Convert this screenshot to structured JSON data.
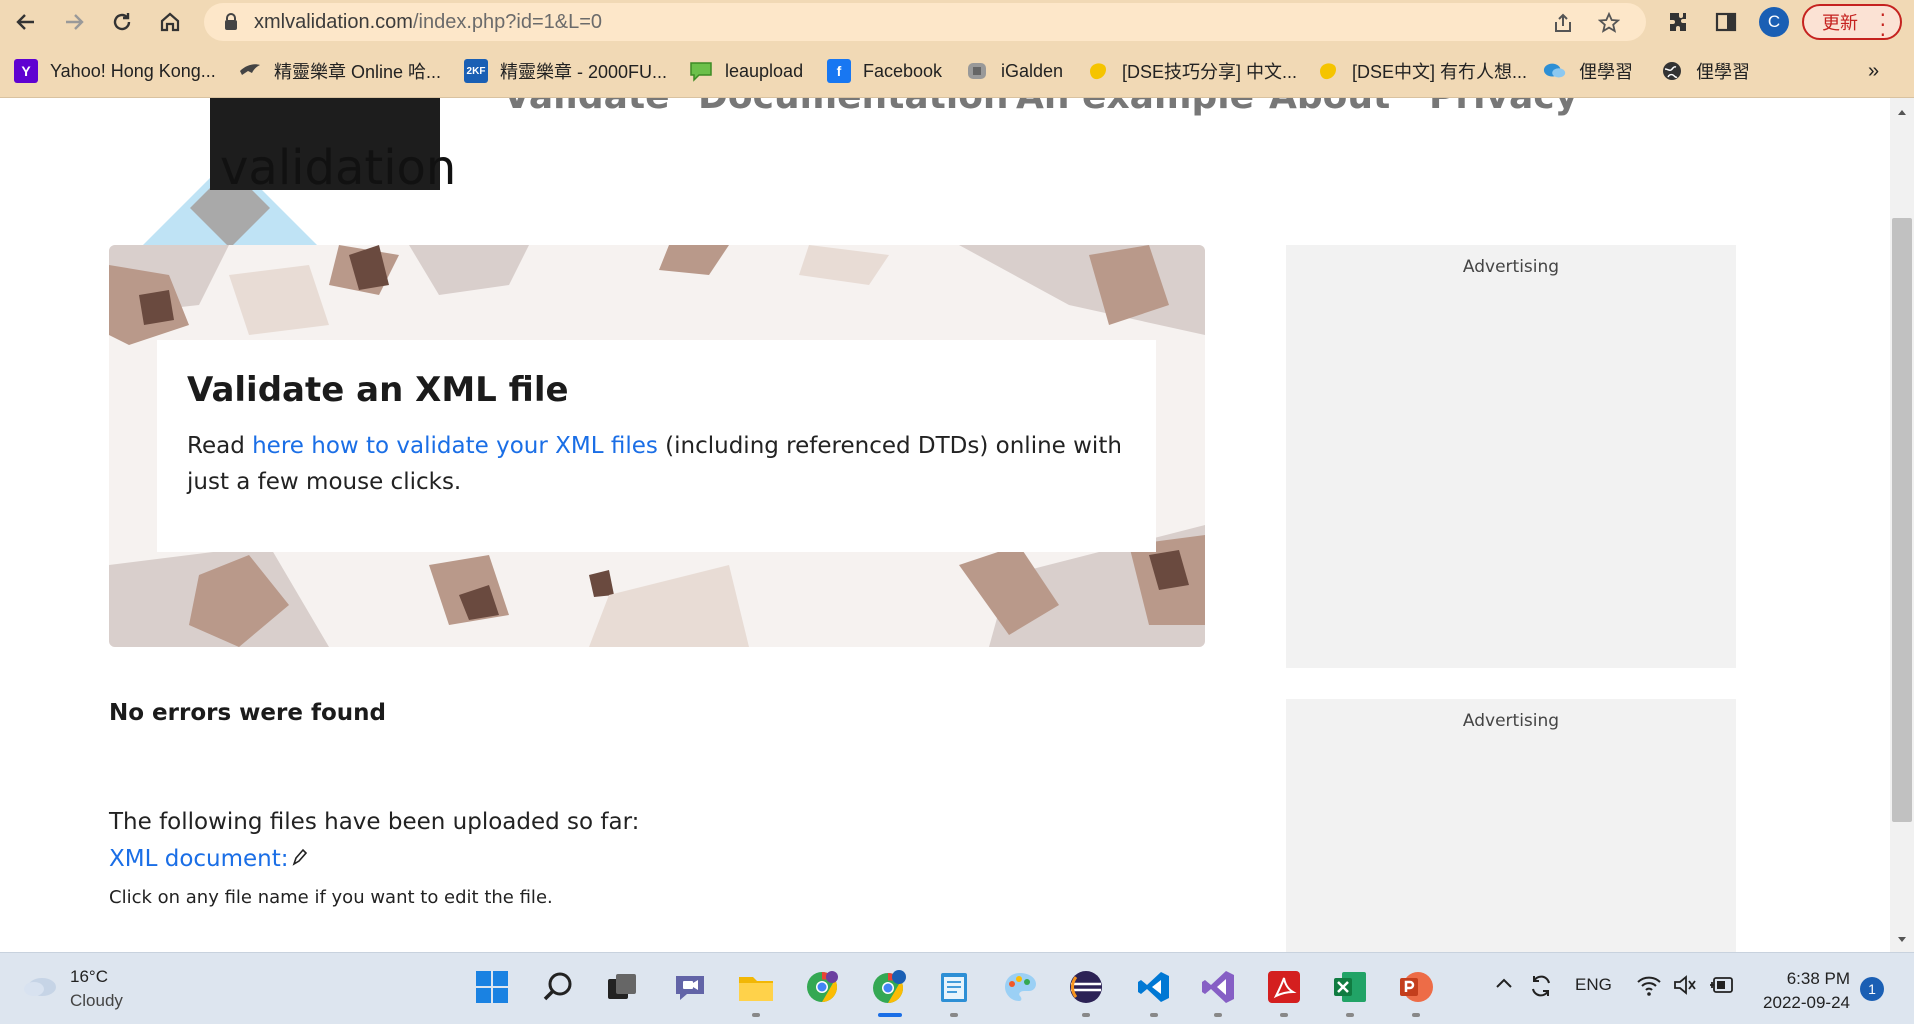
{
  "browser": {
    "url_host": "xmlvalidation.com",
    "url_path": "/index.php?id=1&L=0",
    "update_label": "更新",
    "profile_initial": "C"
  },
  "bookmarks": [
    {
      "label": "Yahoo! Hong Kong...",
      "icon": "yahoo-icon",
      "color": "#5f01d1"
    },
    {
      "label": "精靈樂章 Online 哈...",
      "icon": "bird-icon",
      "color": "#444444"
    },
    {
      "label": "精靈樂章 - 2000FU...",
      "icon": "2kf-icon",
      "color": "#1a5fb4"
    },
    {
      "label": "leaupload",
      "icon": "chat-bubble-icon",
      "color": "#6cc04a"
    },
    {
      "label": "Facebook",
      "icon": "facebook-icon",
      "color": "#1877f2"
    },
    {
      "label": "iGalden",
      "icon": "igalden-icon",
      "color": "#777777"
    },
    {
      "label": "[DSE技巧分享] 中文...",
      "icon": "yellow-blob-icon",
      "color": "#f5c400"
    },
    {
      "label": "[DSE中文] 有冇人想...",
      "icon": "yellow-blob-icon",
      "color": "#f5c400"
    },
    {
      "label": "俚學習",
      "icon": "chat-icon",
      "color": "#2d8fd5"
    },
    {
      "label": "俚學習",
      "icon": "globe-icon",
      "color": "#333333"
    }
  ],
  "site": {
    "logo_text": "validation",
    "nav": [
      "Validate",
      "Documentation",
      "An example",
      "About",
      "Privacy"
    ]
  },
  "hero": {
    "title": "Validate an XML file",
    "text_before": "Read ",
    "link_text": "here how to validate your XML files",
    "text_after": " (including referenced DTDs) online with just a few mouse clicks."
  },
  "result": {
    "status": "No errors were found",
    "files_intro": "The following files have been uploaded so far:",
    "xml_link": "XML document:",
    "edit_hint": "Click on any file name if you want to edit the file."
  },
  "ads": {
    "label_1": "Advertising",
    "label_2": "Advertising"
  },
  "taskbar": {
    "temperature": "16°C",
    "weather": "Cloudy",
    "language": "ENG",
    "time": "6:38 PM",
    "date": "2022-09-24",
    "notifications": "1"
  }
}
